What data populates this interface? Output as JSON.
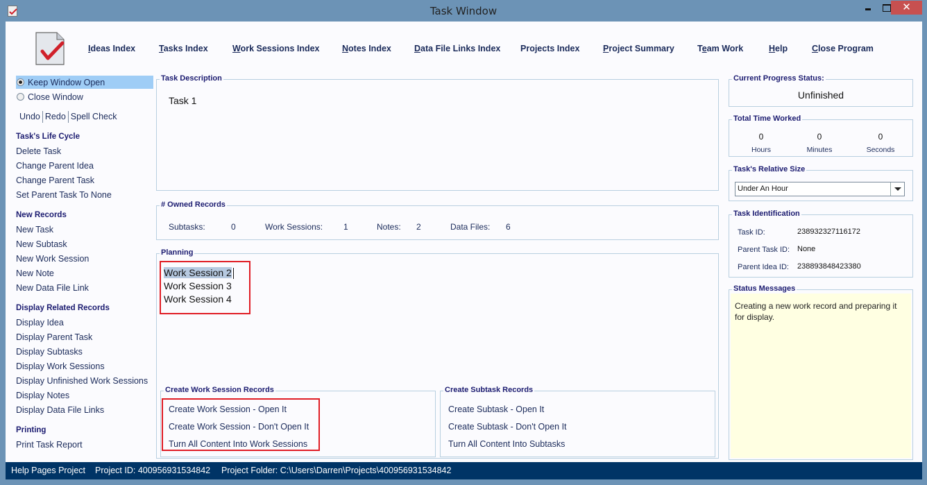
{
  "window": {
    "title": "Task Window",
    "close_glyph": "✕"
  },
  "nav": {
    "items": [
      {
        "label": "Ideas Index",
        "mnemonic": "I"
      },
      {
        "label": "Tasks Index",
        "mnemonic": "T"
      },
      {
        "label": "Work Sessions Index",
        "mnemonic": "W"
      },
      {
        "label": "Notes Index",
        "mnemonic": "N"
      },
      {
        "label": "Data File Links Index",
        "mnemonic": "D"
      },
      {
        "label": "Projects Index",
        "mnemonic": ""
      },
      {
        "label": "Project Summary",
        "mnemonic": "P"
      },
      {
        "label": "Team Work",
        "mnemonic": "e"
      },
      {
        "label": "Help",
        "mnemonic": "H"
      },
      {
        "label": "Close Program",
        "mnemonic": "C"
      }
    ]
  },
  "sidebar": {
    "window_options": [
      {
        "label": "Keep Window Open",
        "selected": true
      },
      {
        "label": "Close Window",
        "selected": false
      }
    ],
    "edit_links": [
      "Undo",
      "Redo",
      "Spell Check"
    ],
    "sections": [
      {
        "heading": "Task's Life Cycle",
        "links": [
          "Delete Task",
          "Change Parent Idea",
          "Change Parent Task",
          "Set Parent Task To None"
        ]
      },
      {
        "heading": "New Records",
        "links": [
          "New Task",
          "New Subtask",
          "New Work Session",
          "New Note",
          "New Data File Link"
        ]
      },
      {
        "heading": "Display Related Records",
        "links": [
          "Display Idea",
          "Display Parent Task",
          "Display Subtasks",
          "Display Work Sessions",
          "Display Unfinished Work Sessions",
          "Display Notes",
          "Display Data File Links"
        ]
      },
      {
        "heading": "Printing",
        "links": [
          "Print Task Report"
        ]
      }
    ]
  },
  "task_description": {
    "label": "Task Description",
    "value": "Task 1"
  },
  "owned_records": {
    "label": "# Owned Records",
    "items": [
      {
        "label": "Subtasks:",
        "value": "0"
      },
      {
        "label": "Work Sessions:",
        "value": "1"
      },
      {
        "label": "Notes:",
        "value": "2"
      },
      {
        "label": "Data Files:",
        "value": "6"
      }
    ]
  },
  "planning": {
    "label": "Planning",
    "lines": [
      "Work Session 2",
      "Work Session 3",
      "Work Session 4"
    ],
    "selected_line": 0
  },
  "create_work_session": {
    "label": "Create Work Session Records",
    "links": [
      "Create Work Session - Open It",
      "Create Work Session - Don't Open It",
      "Turn All Content Into Work Sessions"
    ]
  },
  "create_subtask": {
    "label": "Create Subtask Records",
    "links": [
      "Create Subtask - Open It",
      "Create Subtask - Don't Open It",
      "Turn All Content Into Subtasks"
    ]
  },
  "progress": {
    "label": "Current Progress Status:",
    "value": "Unfinished"
  },
  "time_worked": {
    "label": "Total Time Worked",
    "units": [
      {
        "value": "0",
        "label": "Hours"
      },
      {
        "value": "0",
        "label": "Minutes"
      },
      {
        "value": "0",
        "label": "Seconds"
      }
    ]
  },
  "relative_size": {
    "label": "Task's Relative Size",
    "selected": "Under An Hour"
  },
  "identification": {
    "label": "Task Identification",
    "rows": [
      {
        "label": "Task ID:",
        "value": "238932327116172"
      },
      {
        "label": "Parent Task ID:",
        "value": "None"
      },
      {
        "label": "Parent Idea ID:",
        "value": "238893848423380"
      }
    ]
  },
  "status_messages": {
    "label": "Status Messages",
    "text": "Creating a new work record and preparing it for display."
  },
  "statusbar": {
    "project_name": "Help Pages Project",
    "project_id": "Project ID:  400956931534842",
    "project_folder": "Project Folder: C:\\Users\\Darren\\Projects\\400956931534842"
  },
  "colors": {
    "title_bar": "#6c93b6",
    "close_button": "#c75050",
    "heading_text": "#1b1b70",
    "link_text": "#1a2a5a",
    "highlight": "#9fcdf6",
    "annotation_red": "#e01c24",
    "status_bg": "#ffffe2",
    "statusbar_bg": "#003466"
  }
}
